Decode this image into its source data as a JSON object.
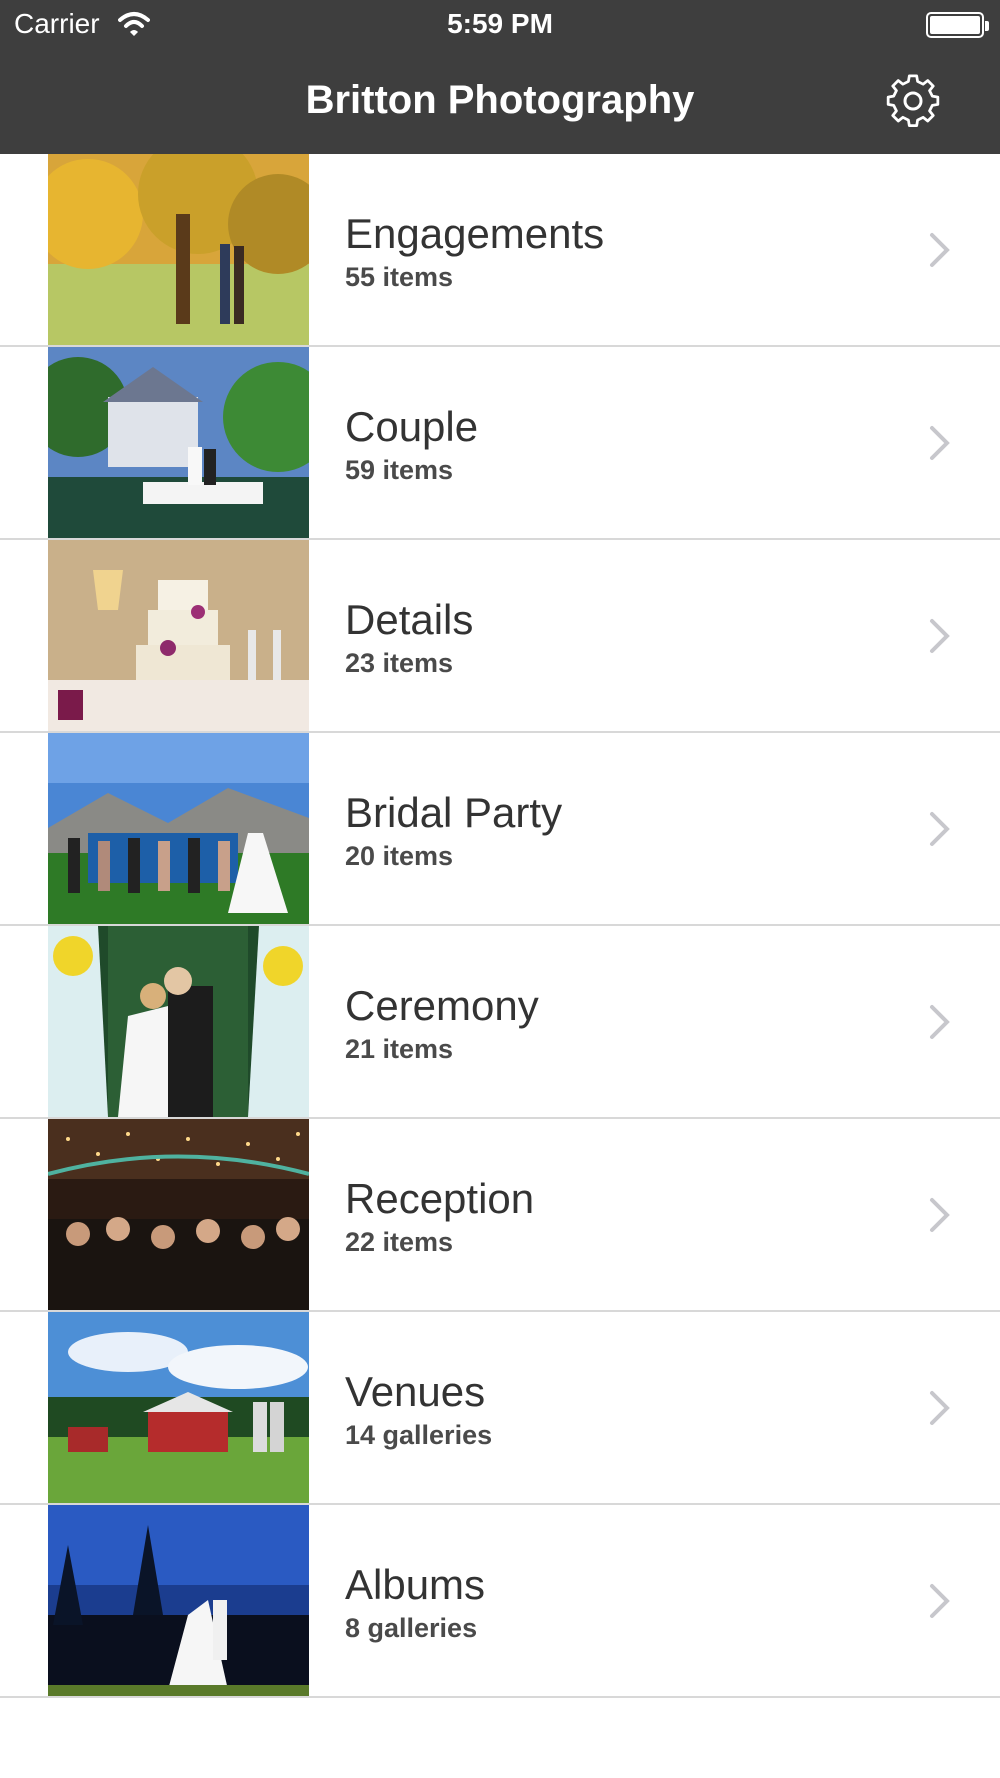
{
  "status_bar": {
    "carrier": "Carrier",
    "time": "5:59 PM"
  },
  "nav": {
    "title": "Britton Photography",
    "settings_icon": "gear-icon"
  },
  "gallery_rows": [
    {
      "title": "Engagements",
      "count": "55 items"
    },
    {
      "title": "Couple",
      "count": "59 items"
    },
    {
      "title": "Details",
      "count": "23 items"
    },
    {
      "title": "Bridal Party",
      "count": "20 items"
    },
    {
      "title": "Ceremony",
      "count": "21 items"
    },
    {
      "title": "Reception",
      "count": "22 items"
    },
    {
      "title": "Venues",
      "count": "14 galleries"
    },
    {
      "title": "Albums",
      "count": "8 galleries"
    }
  ],
  "colors": {
    "nav_background": "#3e3e3e",
    "separator": "#d8d8d8",
    "chevron": "#c7c7cc"
  }
}
